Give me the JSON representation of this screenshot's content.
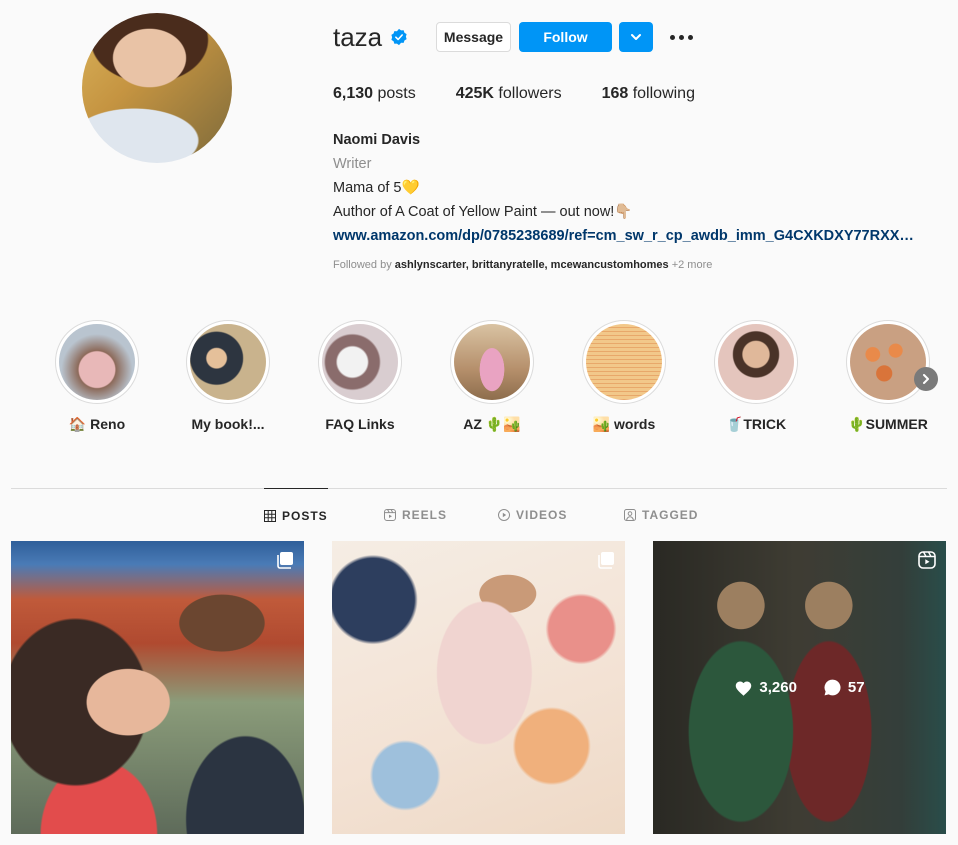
{
  "profile": {
    "username": "taza",
    "verified": true,
    "buttons": {
      "message": "Message",
      "follow": "Follow"
    },
    "stats": {
      "posts": "6,130",
      "posts_label": " posts",
      "followers": "425K",
      "followers_label": " followers",
      "following": "168",
      "following_label": " following"
    },
    "bio": {
      "name": "Naomi Davis",
      "category": "Writer",
      "line1": "Mama of 5💛",
      "line2": "Author of A Coat of Yellow Paint — out now!👇🏼",
      "link": "www.amazon.com/dp/0785238689/ref=cm_sw_r_cp_awdb_imm_G4CXKDXY77RXX…"
    },
    "followed_by": {
      "prefix": "Followed by ",
      "names": "ashlynscarter, brittanyratelle, mcewancustomhomes",
      "more": " +2 more"
    }
  },
  "highlights": [
    {
      "label": "🏠 Reno",
      "color": "#b9c4cf"
    },
    {
      "label": "My book!...",
      "color": "#c9b38d"
    },
    {
      "label": "FAQ Links",
      "color": "#d9cdd0"
    },
    {
      "label": "AZ 🌵🏜️",
      "color": "#b58f6b"
    },
    {
      "label": "🏜️ words",
      "color": "#f2c88a"
    },
    {
      "label": "🥤TRICK",
      "color": "#c99a8a"
    },
    {
      "label": "🌵SUMMER",
      "color": "#d98b5a"
    }
  ],
  "tabs": [
    {
      "label": "POSTS",
      "icon": "grid-icon",
      "active": true
    },
    {
      "label": "REELS",
      "icon": "reels-icon",
      "active": false
    },
    {
      "label": "VIDEOS",
      "icon": "video-icon",
      "active": false
    },
    {
      "label": "TAGGED",
      "icon": "tagged-icon",
      "active": false
    }
  ],
  "posts": [
    {
      "type": "carousel"
    },
    {
      "type": "carousel"
    },
    {
      "type": "reel",
      "likes": "3,260",
      "comments": "57"
    }
  ],
  "colors": {
    "accent": "#0095f6",
    "link": "#00376b",
    "muted": "#8e8e8e"
  }
}
